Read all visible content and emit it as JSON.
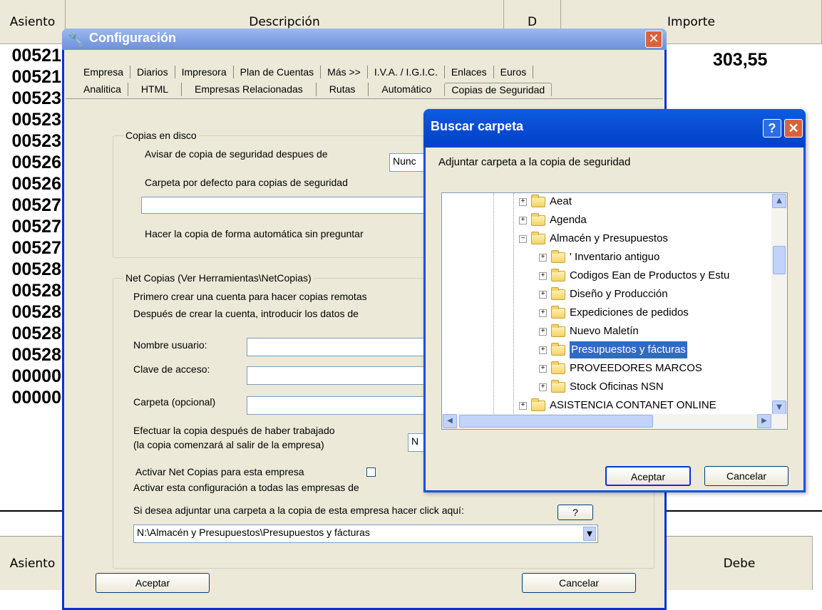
{
  "background": {
    "headers": {
      "asiento": "Asiento",
      "descripcion": "Descripción",
      "d": "D",
      "importe": "Importe"
    },
    "importe_value": "303,55",
    "rows": [
      "00521",
      "00521",
      "00523",
      "00523",
      "00523",
      "00526",
      "00526",
      "00527",
      "00527",
      "00527",
      "00528",
      "00528",
      "00528",
      "00528",
      "00528",
      "00000",
      "00000"
    ],
    "bottom_headers": {
      "asiento": "Asiento",
      "debe": "Debe"
    }
  },
  "config": {
    "title": "Configuración",
    "tabs_row1": [
      "Empresa",
      "Diarios",
      "Impresora",
      "Plan de Cuentas",
      "Más >>",
      "I.V.A. / I.G.I.C.",
      "Enlaces",
      "Euros"
    ],
    "tabs_row2": [
      "Analitica",
      "HTML",
      "Empresas Relacionadas",
      "Rutas",
      "Automático",
      "Copias de Seguridad"
    ],
    "disk_group": {
      "label": "Copias en disco",
      "warn_label": "Avisar de copia de seguridad despues de",
      "warn_value": "Nunc",
      "folder_label": "Carpeta por defecto para copias de seguridad",
      "folder_value": "",
      "auto_label": "Hacer la copia de forma automática sin preguntar"
    },
    "net_group": {
      "label": "Net Copias (Ver Herramientas\\NetCopias)",
      "line1": "Primero crear una cuenta para hacer copias remotas",
      "line2": "Después de crear la cuenta, introducir los datos de",
      "user_label": "Nombre usuario:",
      "pass_label": "Clave de acceso:",
      "folder_label": "Carpeta (opcional)",
      "after_label1": "Efectuar la copia después de haber trabajado",
      "after_label2": "(la copia comenzará al salir de la empresa)",
      "after_value": "N",
      "activate_label": "Activar Net Copias para esta empresa",
      "activate_all_label": "Activar esta configuración a todas las empresas de",
      "attach_label": "Si desea adjuntar una carpeta a la copia de esta empresa hacer click aquí:",
      "attach_button": "?",
      "attach_path": "N:\\Almacén y Presupuestos\\Presupuestos y fácturas"
    },
    "ok_label": "Aceptar",
    "cancel_label": "Cancelar"
  },
  "browse": {
    "title": "Buscar carpeta",
    "help_btn": "?",
    "close_btn": "✕",
    "prompt": "Adjuntar carpeta a la copia de seguridad",
    "tree": [
      {
        "label": "Aeat",
        "sign": "+",
        "level": 0
      },
      {
        "label": "Agenda",
        "sign": "+",
        "level": 0
      },
      {
        "label": "Almacén y Presupuestos",
        "sign": "−",
        "level": 0
      },
      {
        "label": "' Inventario antiguo",
        "sign": "+",
        "level": 1
      },
      {
        "label": "Codigos Ean de Productos y Estu",
        "sign": "+",
        "level": 1
      },
      {
        "label": "Diseño y Producción",
        "sign": "+",
        "level": 1
      },
      {
        "label": "Expediciones de pedidos",
        "sign": "+",
        "level": 1
      },
      {
        "label": "Nuevo Maletín",
        "sign": "+",
        "level": 1
      },
      {
        "label": "Presupuestos y fácturas",
        "sign": "+",
        "level": 1,
        "selected": true
      },
      {
        "label": "PROVEEDORES MARCOS",
        "sign": "+",
        "level": 1
      },
      {
        "label": "Stock Oficinas NSN",
        "sign": "+",
        "level": 1
      },
      {
        "label": "ASISTENCIA CONTANET ONLINE",
        "sign": "+",
        "level": 0
      }
    ],
    "ok_label": "Aceptar",
    "cancel_label": "Cancelar"
  }
}
